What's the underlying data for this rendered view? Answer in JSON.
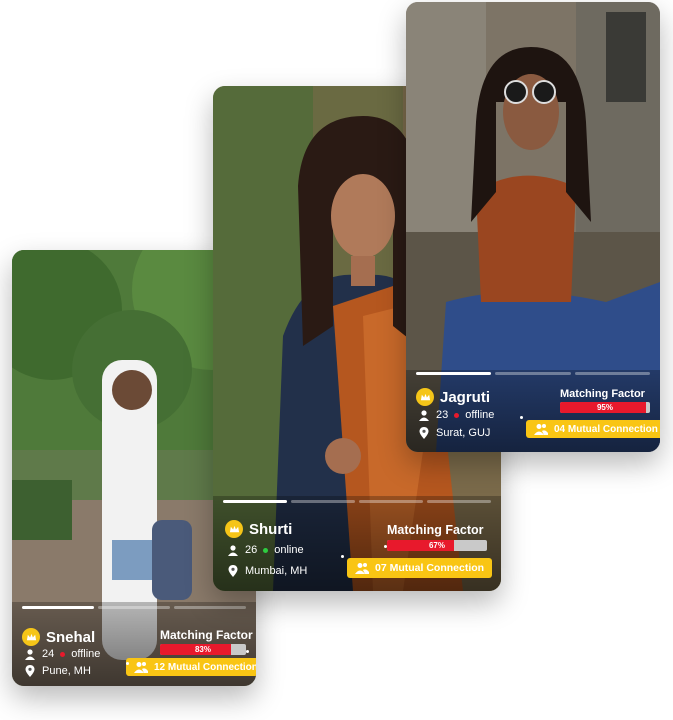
{
  "colors": {
    "accent_yellow": "#f9c514",
    "crown": "#f5c518",
    "bar_fill": "#e8192c",
    "bar_track": "#c9c9c9",
    "online": "#2ecc40",
    "offline": "#e8192c"
  },
  "cards": [
    {
      "name": "Snehal",
      "age": "24",
      "status": "offline",
      "location": "Pune, MH",
      "matching_label": "Matching Factor",
      "matching_pct": "83%",
      "matching_value": 0.83,
      "mutual": "12 Mutual Connection"
    },
    {
      "name": "Shurti",
      "age": "26",
      "status": "online",
      "location": "Mumbai, MH",
      "matching_label": "Matching Factor",
      "matching_pct": "67%",
      "matching_value": 0.67,
      "mutual": "07 Mutual Connection"
    },
    {
      "name": "Jagruti",
      "age": "23",
      "status": "offline",
      "location": "Surat, GUJ",
      "matching_label": "Matching Factor",
      "matching_pct": "95%",
      "matching_value": 0.95,
      "mutual": "04 Mutual Connection"
    }
  ]
}
